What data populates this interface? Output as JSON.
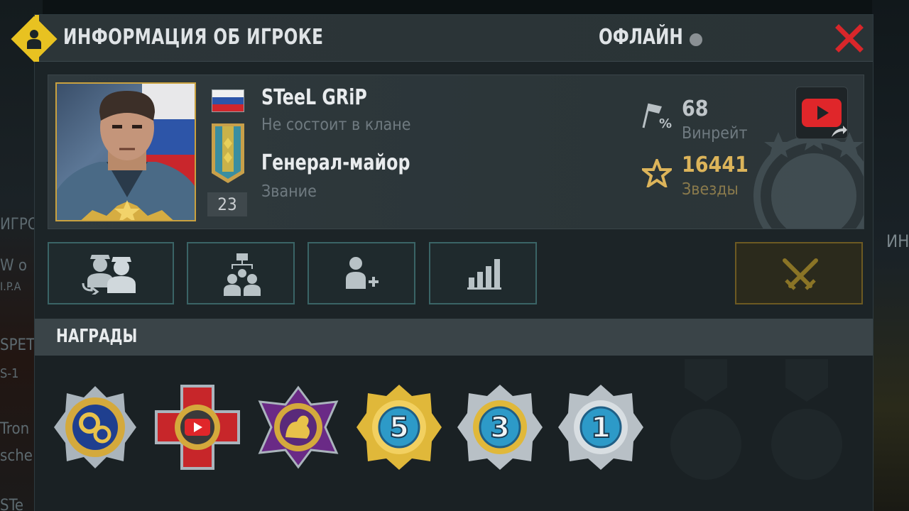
{
  "background": {
    "left_ghost_lines": [
      "ИГРОЙ",
      "W o",
      "I.P.A",
      "SPET",
      "S-1",
      "Tron",
      "sche",
      "STe"
    ],
    "right_ghost": "ИН"
  },
  "window": {
    "title": "ИНФОРМАЦИЯ ОБ ИГРОКЕ",
    "status": "ОФЛАЙН",
    "status_color": "#8a9094",
    "accent_color": "#e8c221",
    "close_icon": "close-x-icon",
    "close_color": "#d9262a"
  },
  "player": {
    "name": "STeeL GRiP",
    "clan": "Не состоит в клане",
    "rank": "Генерал-майор",
    "rank_label": "Звание",
    "level": "23",
    "country_flag": "russia-flag",
    "winrate": {
      "value": "68",
      "label": "Винрейт",
      "icon": "flag-percent-icon"
    },
    "stars": {
      "value": "16441",
      "label": "Звезды",
      "icon": "star-icon",
      "color": "#dcb45a"
    },
    "social_icon": "youtube-share-icon"
  },
  "actions": [
    {
      "name": "compare-players-button",
      "icon": "soldiers-swap-icon"
    },
    {
      "name": "clan-invite-button",
      "icon": "group-hierarchy-icon"
    },
    {
      "name": "add-friend-button",
      "icon": "add-person-icon"
    },
    {
      "name": "statistics-button",
      "icon": "bar-chart-icon"
    },
    {
      "name": "challenge-button",
      "icon": "crossed-swords-icon"
    }
  ],
  "awards": {
    "title": "НАГРАДЫ",
    "medals": [
      {
        "name": "medal-gears",
        "icon": "gears-medal-icon"
      },
      {
        "name": "medal-youtube",
        "icon": "youtube-cross-medal-icon"
      },
      {
        "name": "medal-strength",
        "icon": "flexed-arm-medal-icon"
      },
      {
        "name": "medal-5",
        "icon": "gold-medal-5-icon",
        "number": "5"
      },
      {
        "name": "medal-3",
        "icon": "silver-gold-medal-3-icon",
        "number": "3"
      },
      {
        "name": "medal-1",
        "icon": "silver-medal-1-icon",
        "number": "1"
      }
    ]
  }
}
